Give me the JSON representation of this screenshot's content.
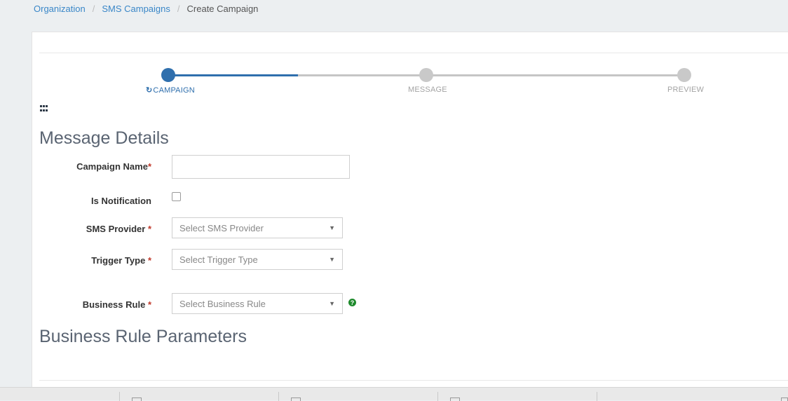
{
  "breadcrumb": {
    "items": [
      "Organization",
      "SMS Campaigns"
    ],
    "current": "Create Campaign"
  },
  "stepper": {
    "steps": [
      {
        "label": "CAMPAIGN",
        "active": true
      },
      {
        "label": "MESSAGE",
        "active": false
      },
      {
        "label": "PREVIEW",
        "active": false
      }
    ]
  },
  "sections": {
    "details_title": "Message Details",
    "params_title": "Business Rule Parameters"
  },
  "form": {
    "campaign_name_label": "Campaign Name",
    "campaign_name_value": "",
    "is_notification_label": "Is Notification",
    "sms_provider_label": "SMS Provider",
    "sms_provider_placeholder": "Select SMS Provider",
    "trigger_type_label": "Trigger Type",
    "trigger_type_placeholder": "Select Trigger Type",
    "business_rule_label": "Business Rule",
    "business_rule_placeholder": "Select Business Rule",
    "required_mark": "*"
  },
  "icons": {
    "grid": "grid-icon",
    "help": "question-circle-icon",
    "refresh": "refresh-icon",
    "caret": "caret-down-icon"
  },
  "colors": {
    "accent": "#2f6fad",
    "link": "#3a87c8",
    "required": "#c0392b",
    "help": "#1e8a2c"
  }
}
